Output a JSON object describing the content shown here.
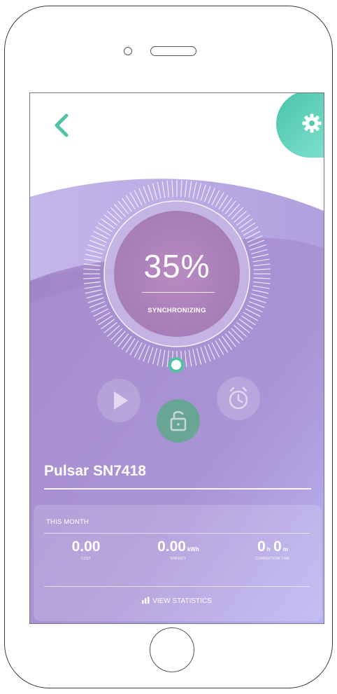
{
  "screen": {
    "progress_percent": "35%",
    "progress_value": 0.35,
    "status_label": "SYNCHRONIZING",
    "device_name": "Pulsar SN7418"
  },
  "icons": {
    "back": "chevron-left-icon",
    "settings": "gear-icon",
    "play": "play-icon",
    "lock": "lock-icon",
    "alarm": "alarm-clock-icon",
    "stats": "bar-chart-icon"
  },
  "month_card": {
    "title": "THIS MONTH",
    "cost": {
      "value": "0.00",
      "label": "COST"
    },
    "energy": {
      "value": "0.00",
      "unit": "kWh",
      "label": "ENERGY"
    },
    "connection": {
      "hours": "0",
      "hours_unit": "h",
      "minutes": "0",
      "minutes_unit": "m",
      "label": "CONNECTION TIME"
    },
    "view_stats_label": "VIEW STATISTICS"
  },
  "colors": {
    "accent": "#4fc3a7",
    "purple_light": "#b7a7e0",
    "purple": "#9a7fc4",
    "lavender": "#b8b3f2"
  }
}
